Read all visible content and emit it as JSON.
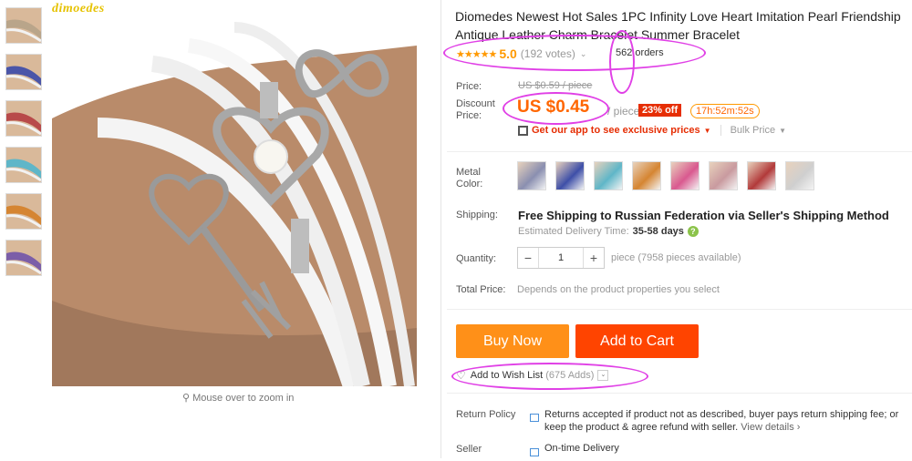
{
  "brand": "dimoedes",
  "zoom_hint": "Mouse over to zoom in",
  "product": {
    "title": "Diomedes Newest Hot Sales 1PC Infinity Love Heart Imitation Pearl Friendship Antique Leather Charm Bracelet Summer Bracelet",
    "stars": "★★★★★",
    "rating": "5.0",
    "votes": "(192 votes)",
    "orders": "562 orders"
  },
  "pricing": {
    "price_label": "Price:",
    "old_price": "US $0.59 / piece",
    "discount_label_1": "Discount",
    "discount_label_2": "Price:",
    "price": "US $0.45",
    "unit": "/ piece",
    "off": "23% off",
    "timer": "17h:52m:52s",
    "app_promo": "Get our app to see exclusive prices",
    "bulk": "Bulk Price"
  },
  "options": {
    "color_label_1": "Metal",
    "color_label_2": "Color:",
    "swatch_colors": [
      "#8a8fb0",
      "#3e4fa8",
      "#5fb6c8",
      "#d58532",
      "#d9598f",
      "#c99a9f",
      "#b23a3a",
      "#cfcfcf"
    ]
  },
  "shipping": {
    "label": "Shipping:",
    "main": "Free Shipping to Russian Federation via Seller's Shipping Method",
    "estimate_label": "Estimated Delivery Time:",
    "estimate_days": "35-58 days",
    "help_icon": "?"
  },
  "quantity": {
    "label": "Quantity:",
    "minus": "−",
    "value": "1",
    "plus": "+",
    "note": "piece (7958 pieces available)"
  },
  "total": {
    "label": "Total Price:",
    "note": "Depends on the product properties you select"
  },
  "actions": {
    "buy_now": "Buy Now",
    "add_to_cart": "Add to Cart",
    "wishlist": "Add to Wish List",
    "wishlist_count": "(675 Adds)"
  },
  "policy": {
    "label": "Return Policy",
    "text": "Returns accepted if product not as described, buyer pays return shipping fee; or keep the product & agree refund with seller.",
    "link": "View details ›",
    "seller_label": "Seller",
    "ontime": "On-time Delivery"
  },
  "thumb_colors": [
    "#b9a58a",
    "#4a55a8",
    "#b84a4a",
    "#5fb6c8",
    "#d58532",
    "#7b5ea8"
  ],
  "colors": {
    "accent": "#f60",
    "buy": "#ff9018",
    "cart": "#ff4400",
    "annotation": "#e040e6"
  }
}
